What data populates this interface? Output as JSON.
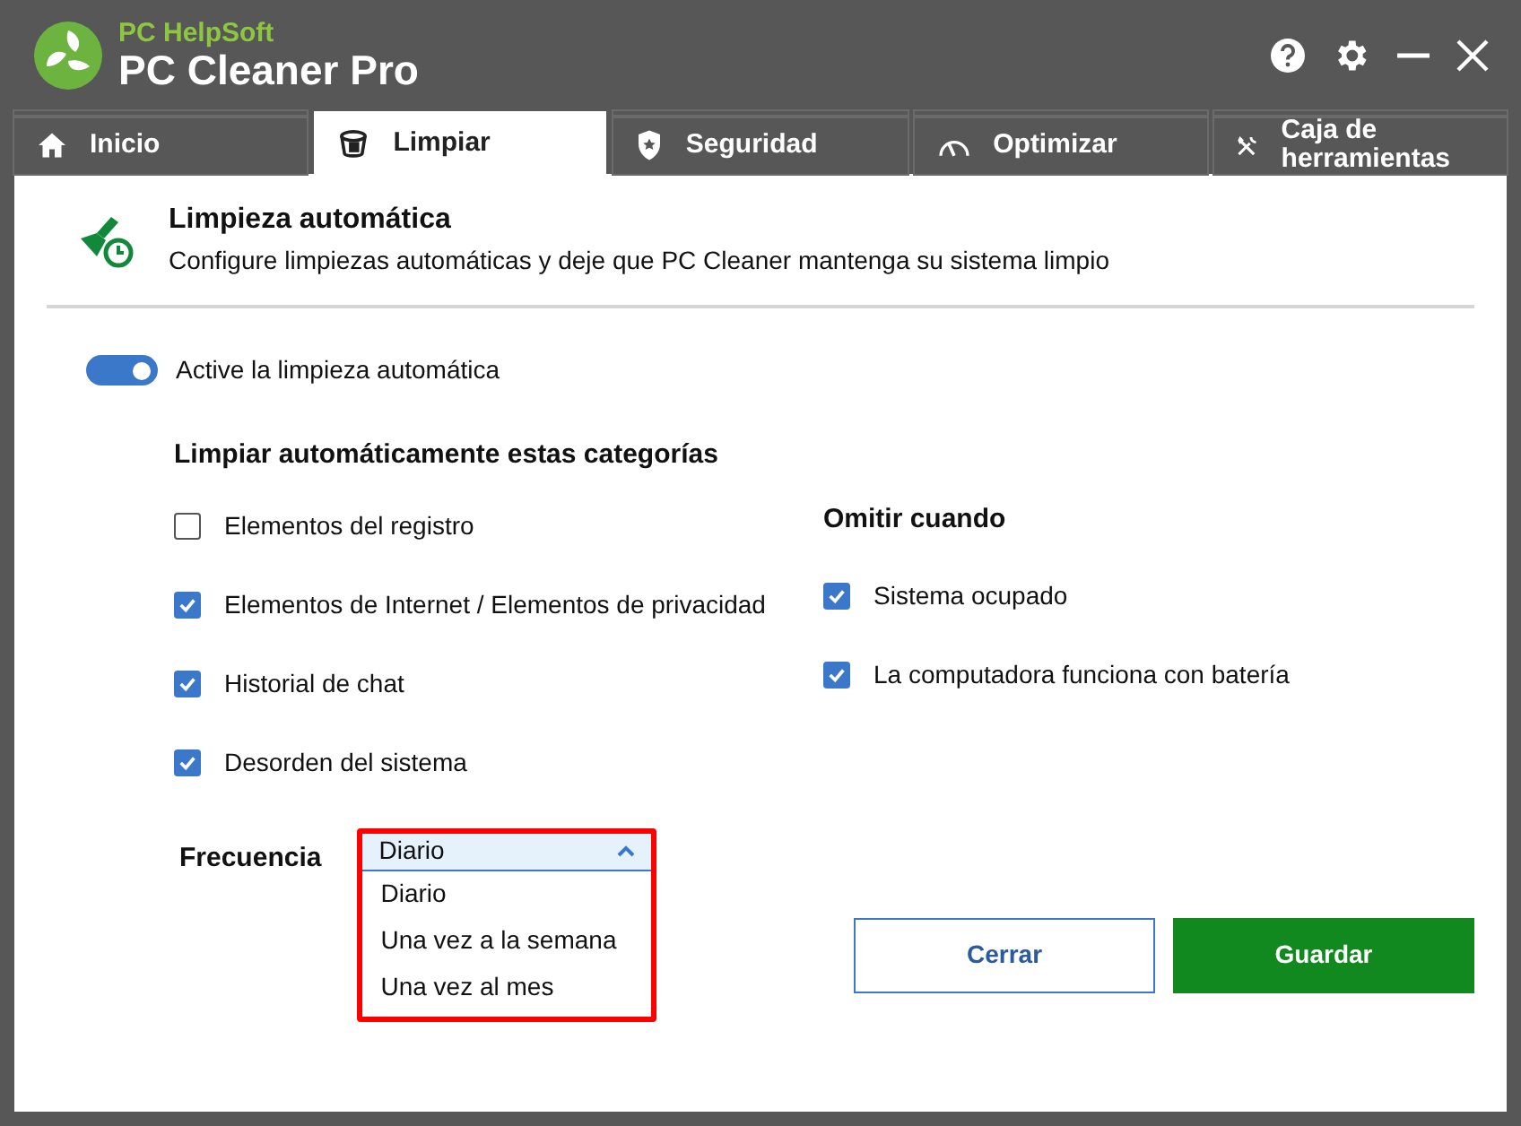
{
  "app": {
    "brand": "PC HelpSoft",
    "title": "PC Cleaner Pro"
  },
  "tabs": [
    {
      "label": "Inicio",
      "selected": false
    },
    {
      "label": "Limpiar",
      "selected": true
    },
    {
      "label": "Seguridad",
      "selected": false
    },
    {
      "label": "Optimizar",
      "selected": false
    },
    {
      "label": "Caja de herramientas",
      "selected": false
    }
  ],
  "header": {
    "title": "Limpieza automática",
    "subtitle": "Configure limpiezas automáticas y deje que PC Cleaner mantenga su sistema limpio"
  },
  "auto_clean_toggle": {
    "label": "Active la limpieza automática",
    "on": true
  },
  "categories": {
    "heading": "Limpiar automáticamente estas categorías",
    "items": [
      {
        "label": "Elementos del registro",
        "checked": false
      },
      {
        "label": "Elementos de Internet / Elementos de privacidad",
        "checked": true
      },
      {
        "label": "Historial de chat",
        "checked": true
      },
      {
        "label": "Desorden del sistema",
        "checked": true
      }
    ]
  },
  "skip_when": {
    "heading": "Omitir cuando",
    "items": [
      {
        "label": "Sistema ocupado",
        "checked": true
      },
      {
        "label": "La computadora funciona con batería",
        "checked": true
      }
    ]
  },
  "frequency": {
    "label": "Frecuencia",
    "value": "Diario",
    "expanded": true,
    "highlighted": true,
    "options": [
      "Diario",
      "Una vez a la semana",
      "Una vez al mes"
    ]
  },
  "buttons": [
    {
      "label": "Cerrar",
      "kind": "secondary"
    },
    {
      "label": "Guardar",
      "kind": "primary"
    }
  ]
}
